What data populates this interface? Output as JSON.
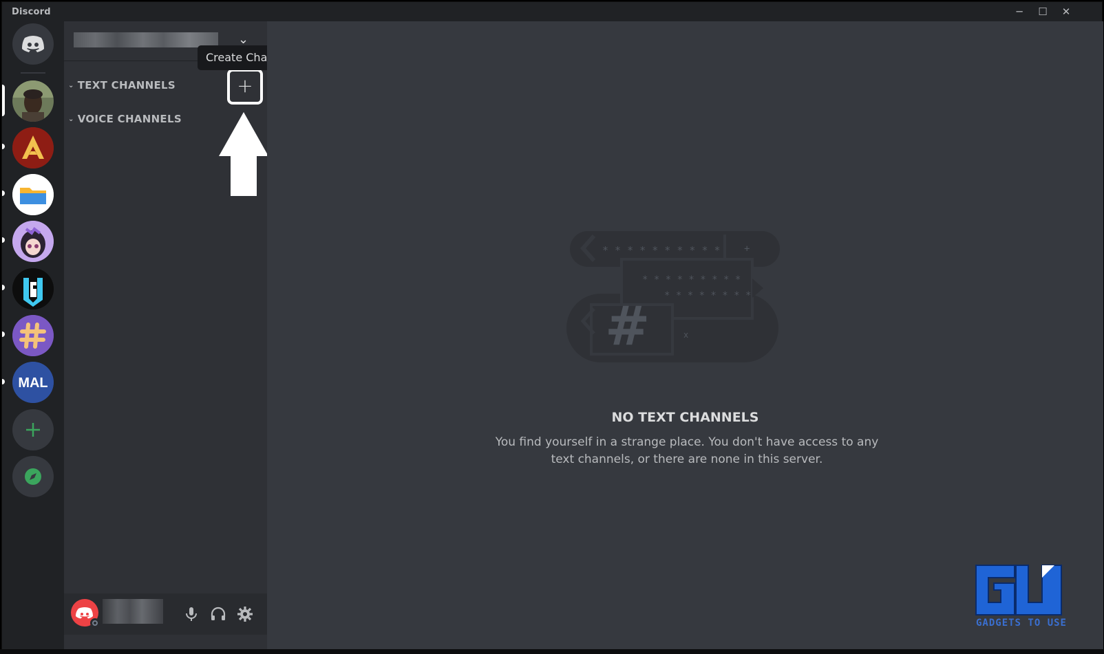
{
  "titlebar": {
    "app_name": "Discord",
    "minimize": "─",
    "maximize": "☐",
    "close": "✕"
  },
  "servers": [
    {
      "name": "home",
      "icon": "discord-logo-icon",
      "color": "#36393f"
    },
    {
      "name": "server-1",
      "icon": "avatar-image",
      "selected": true
    },
    {
      "name": "server-2",
      "icon": "apex-legends-icon",
      "color": "#9b2318"
    },
    {
      "name": "server-3",
      "icon": "folder-icon",
      "color": "#ffffff"
    },
    {
      "name": "server-4",
      "icon": "anime-avatar-icon",
      "color": "#b795e6"
    },
    {
      "name": "server-5",
      "icon": "rainbow-six-icon",
      "color": "#0d0d0d"
    },
    {
      "name": "server-6",
      "icon": "hash-badge-icon",
      "color": "#7b58c4"
    },
    {
      "name": "server-7",
      "icon_text": "MAL",
      "color": "#2e51a2"
    },
    {
      "name": "add-server",
      "icon": "plus-icon",
      "color": "#3ba55d"
    },
    {
      "name": "explore",
      "icon": "compass-icon",
      "color": "#3ba55d"
    }
  ],
  "sidebar": {
    "tooltip": "Create Channel",
    "create_channel_plus": "+",
    "header_chevron": "⌄",
    "categories": [
      {
        "label": "TEXT CHANNELS",
        "chevron": "⌄"
      },
      {
        "label": "VOICE CHANNELS",
        "chevron": "⌄"
      }
    ]
  },
  "user_panel": {
    "mic_icon": "microphone-icon",
    "headphones_icon": "headphones-icon",
    "settings_icon": "gear-icon"
  },
  "main": {
    "empty_title": "NO TEXT CHANNELS",
    "empty_desc_line1": "You find yourself in a strange place. You don't have access to any",
    "empty_desc_line2": "text channels, or there are none in this server.",
    "illustration_stars_1": "* * * * * * * * * *",
    "illustration_stars_2": "* * * * * * * * *",
    "illustration_stars_3": "* * * * * * * *",
    "illustration_hash": "#"
  },
  "watermark": {
    "text": "GADGETS TO USE"
  },
  "colors": {
    "background_rail": "#202225",
    "background_sidebar": "#2f3136",
    "background_main": "#36393f",
    "accent_green": "#3ba55d",
    "accent_red": "#ed4245"
  }
}
